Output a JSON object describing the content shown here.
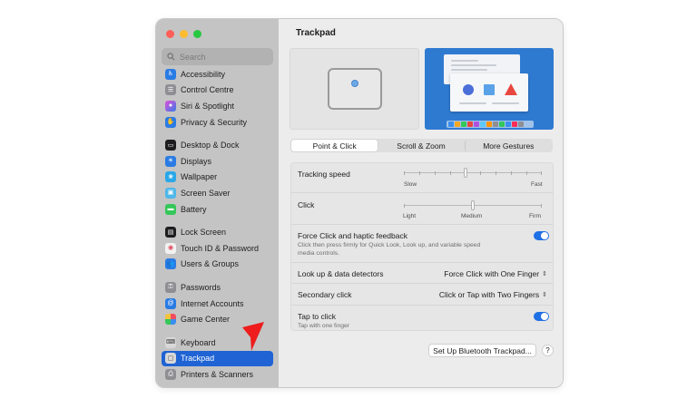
{
  "window": {
    "search": {
      "placeholder": "Search"
    },
    "sidebar": {
      "items": [
        {
          "label": "Accessibility",
          "icon": "accessibility-icon",
          "color": "#2a7be4"
        },
        {
          "label": "Control Centre",
          "icon": "control-centre-icon",
          "color": "#8e8e93"
        },
        {
          "label": "Siri & Spotlight",
          "icon": "siri-icon",
          "color": "#6b4bd8"
        },
        {
          "label": "Privacy & Security",
          "icon": "privacy-hand-icon",
          "color": "#2a7be4"
        },
        {
          "label": "Desktop & Dock",
          "icon": "desktop-dock-icon",
          "color": "#1d1d1f"
        },
        {
          "label": "Displays",
          "icon": "displays-icon",
          "color": "#2a7be4"
        },
        {
          "label": "Wallpaper",
          "icon": "wallpaper-icon",
          "color": "#29a7e8"
        },
        {
          "label": "Screen Saver",
          "icon": "screen-saver-icon",
          "color": "#4fb7e9"
        },
        {
          "label": "Battery",
          "icon": "battery-icon",
          "color": "#34c759"
        },
        {
          "label": "Lock Screen",
          "icon": "lock-screen-icon",
          "color": "#1d1d1f"
        },
        {
          "label": "Touch ID & Password",
          "icon": "touch-id-icon",
          "color": "#f2f2f2"
        },
        {
          "label": "Users & Groups",
          "icon": "users-groups-icon",
          "color": "#2a7be4"
        },
        {
          "label": "Passwords",
          "icon": "passwords-key-icon",
          "color": "#8e8e93"
        },
        {
          "label": "Internet Accounts",
          "icon": "internet-accounts-icon",
          "color": "#2a7be4"
        },
        {
          "label": "Game Center",
          "icon": "game-center-icon",
          "color": "#f2f2f2"
        },
        {
          "label": "Keyboard",
          "icon": "keyboard-icon",
          "color": "#d8d8d8"
        },
        {
          "label": "Trackpad",
          "icon": "trackpad-icon",
          "color": "#d8d8d8",
          "selected": true
        },
        {
          "label": "Printers & Scanners",
          "icon": "printer-icon",
          "color": "#8e8e93"
        }
      ]
    }
  },
  "main": {
    "title": "Trackpad",
    "tabs": [
      {
        "label": "Point & Click",
        "active": true
      },
      {
        "label": "Scroll & Zoom",
        "active": false
      },
      {
        "label": "More Gestures",
        "active": false
      }
    ],
    "settings": {
      "tracking_speed": {
        "label": "Tracking speed",
        "min_label": "Slow",
        "max_label": "Fast",
        "value_fraction": 0.45
      },
      "click": {
        "label": "Click",
        "labels": [
          "Light",
          "Medium",
          "Firm"
        ],
        "value_fraction": 0.5
      },
      "force_click": {
        "label": "Force Click and haptic feedback",
        "description_line1": "Click then press firmly for Quick Look, Look up, and variable speed",
        "description_line2": "media controls.",
        "enabled": true
      },
      "look_up": {
        "label": "Look up & data detectors",
        "value": "Force Click with One Finger"
      },
      "secondary_click": {
        "label": "Secondary click",
        "value": "Click or Tap with Two Fingers"
      },
      "tap_to_click": {
        "label": "Tap to click",
        "description": "Tap with one finger",
        "enabled": true
      }
    },
    "bluetooth_button": "Set Up Bluetooth Trackpad...",
    "help_button": "?"
  },
  "colors": {
    "accent": "#1f63d4",
    "toggle_on": "#1f6fe5",
    "annotation_arrow": "#ee1c1c"
  }
}
